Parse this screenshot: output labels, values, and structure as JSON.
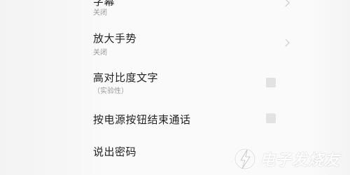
{
  "settings": [
    {
      "title": "字幕",
      "subtitle": "关闭",
      "control": "chevron"
    },
    {
      "title": "放大手势",
      "subtitle": "关闭",
      "control": "chevron"
    },
    {
      "title": "高对比度文字",
      "subtitle": "（实验性）",
      "control": "switch"
    },
    {
      "title": "按电源按钮结束通话",
      "subtitle": "",
      "control": "switch"
    },
    {
      "title": "说出密码",
      "subtitle": "",
      "control": "none"
    }
  ],
  "watermark": {
    "text": "电子发烧友",
    "icon": "lightning-bolt-icon"
  }
}
